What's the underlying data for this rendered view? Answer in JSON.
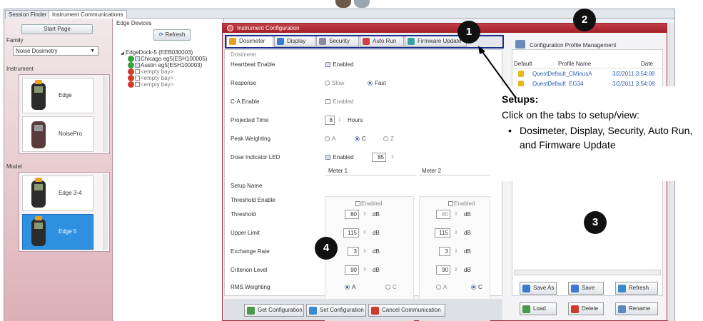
{
  "top_tabs": [
    "Session Finder",
    "Instrument Communications"
  ],
  "left_panel": {
    "start_page": "Start Page",
    "family_label": "Family",
    "family_value": "Noise Dosimetry",
    "instrument_label": "Instrument",
    "instruments": [
      "Edge",
      "NoisePro"
    ],
    "model_label": "Model",
    "models": [
      "Edge 3-4",
      "Edge 5"
    ]
  },
  "edge_devices": {
    "label": "Edge Devices",
    "refresh": "Refresh",
    "dock": "EdgeDock-5 (EEB030003)",
    "items": [
      {
        "label": "Chicago eg5(ESH100005)",
        "status": "ok"
      },
      {
        "label": "Austin eg5(ESH100003)",
        "status": "ok"
      },
      {
        "label": "<empty bay>",
        "status": "error"
      },
      {
        "label": "<empty bay>",
        "status": "error"
      },
      {
        "label": "<empty bay>",
        "status": "error"
      }
    ]
  },
  "dialog": {
    "title": "Instrument Configuration",
    "tabs": [
      "Dosimeter",
      "Display",
      "Security",
      "Auto Run",
      "Firmware Update"
    ],
    "section": "Dosimeter",
    "heartbeat_label": "Heartbeat Enable",
    "heartbeat_value": "Enabled",
    "response_label": "Response",
    "response_slow": "Slow",
    "response_fast": "Fast",
    "ca_label": "C-A Enable",
    "ca_value": "Enabled",
    "projected_label": "Projected Time",
    "projected_value": "8",
    "projected_unit": "Hours",
    "peak_label": "Peak Weighting",
    "peak_a": "A",
    "peak_c": "C",
    "peak_z": "Z",
    "dose_led_label": "Dose Indicator LED",
    "dose_led_value": "Enabled",
    "dose_led_num": "85",
    "meter1": "Meter 1",
    "meter2": "Meter 2",
    "setup_name": "Setup Name",
    "threshold_enable": "Threshold Enable",
    "enabled": "Enabled",
    "threshold": "Threshold",
    "upper_limit": "Upper Limit",
    "exchange_rate": "Exchange Rate",
    "criterion_level": "Criterion Level",
    "rms_weighting": "RMS Weighting",
    "db": "dB",
    "m1": {
      "threshold": "80",
      "upper": "115",
      "exchange": "3",
      "criterion": "90",
      "rms_a": "A",
      "rms_c": "C"
    },
    "m2": {
      "threshold": "80",
      "upper": "115",
      "exchange": "3",
      "criterion": "90",
      "rms_a": "A",
      "rms_c": "C"
    },
    "get_config": "Get Configuration",
    "set_config": "Set Configuration",
    "cancel_comm": "Cancel Communication"
  },
  "profiles": {
    "title": "Configuration Profile Management",
    "col_default": "Default",
    "col_name": "Profile Name",
    "col_date": "Date",
    "rows": [
      {
        "name": "QuestDefault_CMinusA",
        "date": "3/2/2011 3:54:08"
      },
      {
        "name": "QuestDefault_EG34",
        "date": "3/2/2011 3:54:08"
      }
    ],
    "save_as": "Save As",
    "save": "Save",
    "refresh": "Refresh",
    "load": "Load",
    "delete": "Delete",
    "rename": "Rename"
  },
  "annotation": {
    "title": "Setups:",
    "text": "Click on the tabs to setup/view:",
    "bullet": "Dosimeter,  Display, Security, Auto Run, and Firmware Update"
  },
  "callouts": [
    "1",
    "2",
    "3",
    "4"
  ],
  "colors": {
    "accent_red": "#a51e28",
    "selected_blue": "#2e90e0",
    "highlight_border": "#1b2f8a"
  }
}
